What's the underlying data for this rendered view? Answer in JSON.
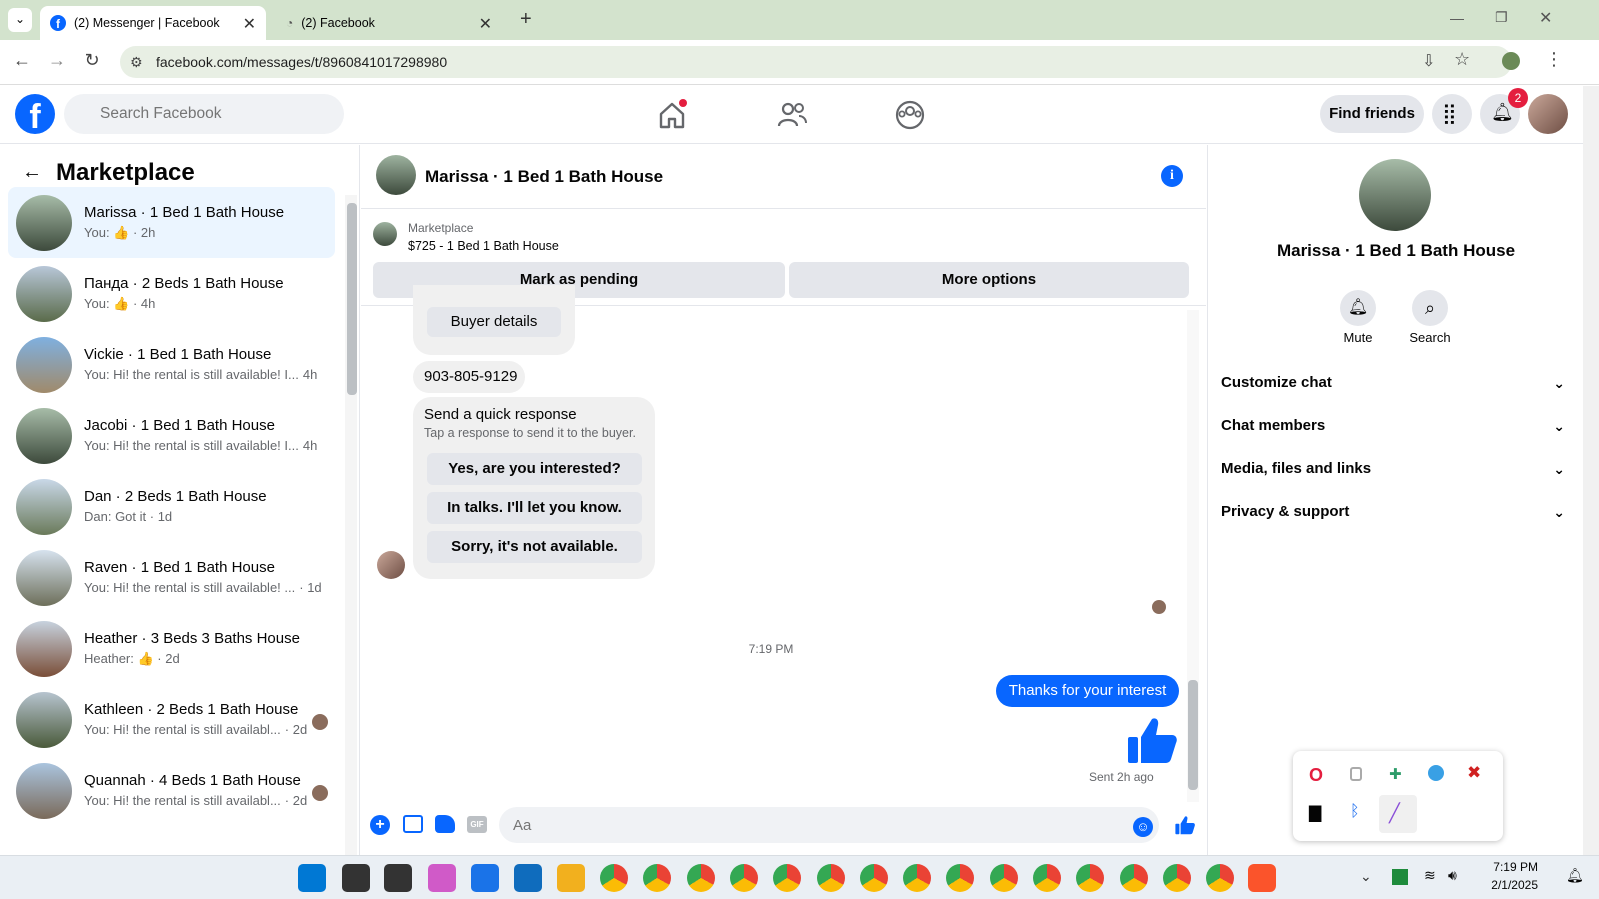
{
  "browser": {
    "tabs": [
      {
        "title": "(2) Messenger | Facebook",
        "active": true
      },
      {
        "title": "(2) Facebook",
        "active": false
      }
    ],
    "url": "facebook.com/messages/t/8960841017298980"
  },
  "header": {
    "search_placeholder": "Search Facebook",
    "find_friends": "Find friends",
    "notification_count": "2"
  },
  "left": {
    "title": "Marketplace",
    "conversations": [
      {
        "name": "Marissa · 1 Bed 1 Bath House",
        "preview": "You: 👍 · 2h",
        "selected": true
      },
      {
        "name": "Панда · 2 Beds 1 Bath House",
        "preview": "You: 👍 · 4h"
      },
      {
        "name": "Vickie · 1 Bed 1 Bath House",
        "preview": "You: Hi! the rental is still available! I...",
        "time": "4h"
      },
      {
        "name": "Jacobi · 1 Bed 1 Bath House",
        "preview": "You: Hi! the rental is still available! I...",
        "time": "4h"
      },
      {
        "name": "Dan · 2 Beds 1 Bath House",
        "preview": "Dan: Got it · 1d"
      },
      {
        "name": "Raven · 1 Bed 1 Bath House",
        "preview": "You: Hi! the rental is still available! ...",
        "time": "· 1d"
      },
      {
        "name": "Heather · 3 Beds 3 Baths House",
        "preview": "Heather: 👍 · 2d"
      },
      {
        "name": "Kathleen · 2 Beds 1 Bath House",
        "preview": "You: Hi! the rental is still availabl...",
        "time": "· 2d"
      },
      {
        "name": "Quannah · 4 Beds 1 Bath House",
        "preview": "You: Hi! the rental is still availabl...",
        "time": "· 2d"
      }
    ]
  },
  "chat": {
    "title": "Marissa · 1 Bed 1 Bath House",
    "listing": {
      "source": "Marketplace",
      "price_title": "$725 - 1 Bed 1 Bath House",
      "mark_pending": "Mark as pending",
      "more_options": "More options"
    },
    "buyer_details": "Buyer details",
    "phone": "903-805-9129",
    "quick_response": {
      "title": "Send a quick response",
      "subtitle": "Tap a response to send it to the buyer.",
      "options": [
        "Yes, are you interested?",
        "In talks. I'll let you know.",
        "Sorry, it's not available."
      ]
    },
    "timestamp": "7:19 PM",
    "sent_message": "Thanks for your interest",
    "sent_status": "Sent 2h ago",
    "input_placeholder": "Aa"
  },
  "right": {
    "name": "Marissa · 1 Bed 1 Bath House",
    "mute": "Mute",
    "search": "Search",
    "sections": [
      "Customize chat",
      "Chat members",
      "Media, files and links",
      "Privacy & support"
    ]
  },
  "taskbar": {
    "time": "7:19 PM",
    "date": "2/1/2025"
  },
  "colors": {
    "fb_blue": "#0866ff",
    "selected_bg": "#ebf5ff",
    "tab_bar": "#d3e3cd"
  }
}
